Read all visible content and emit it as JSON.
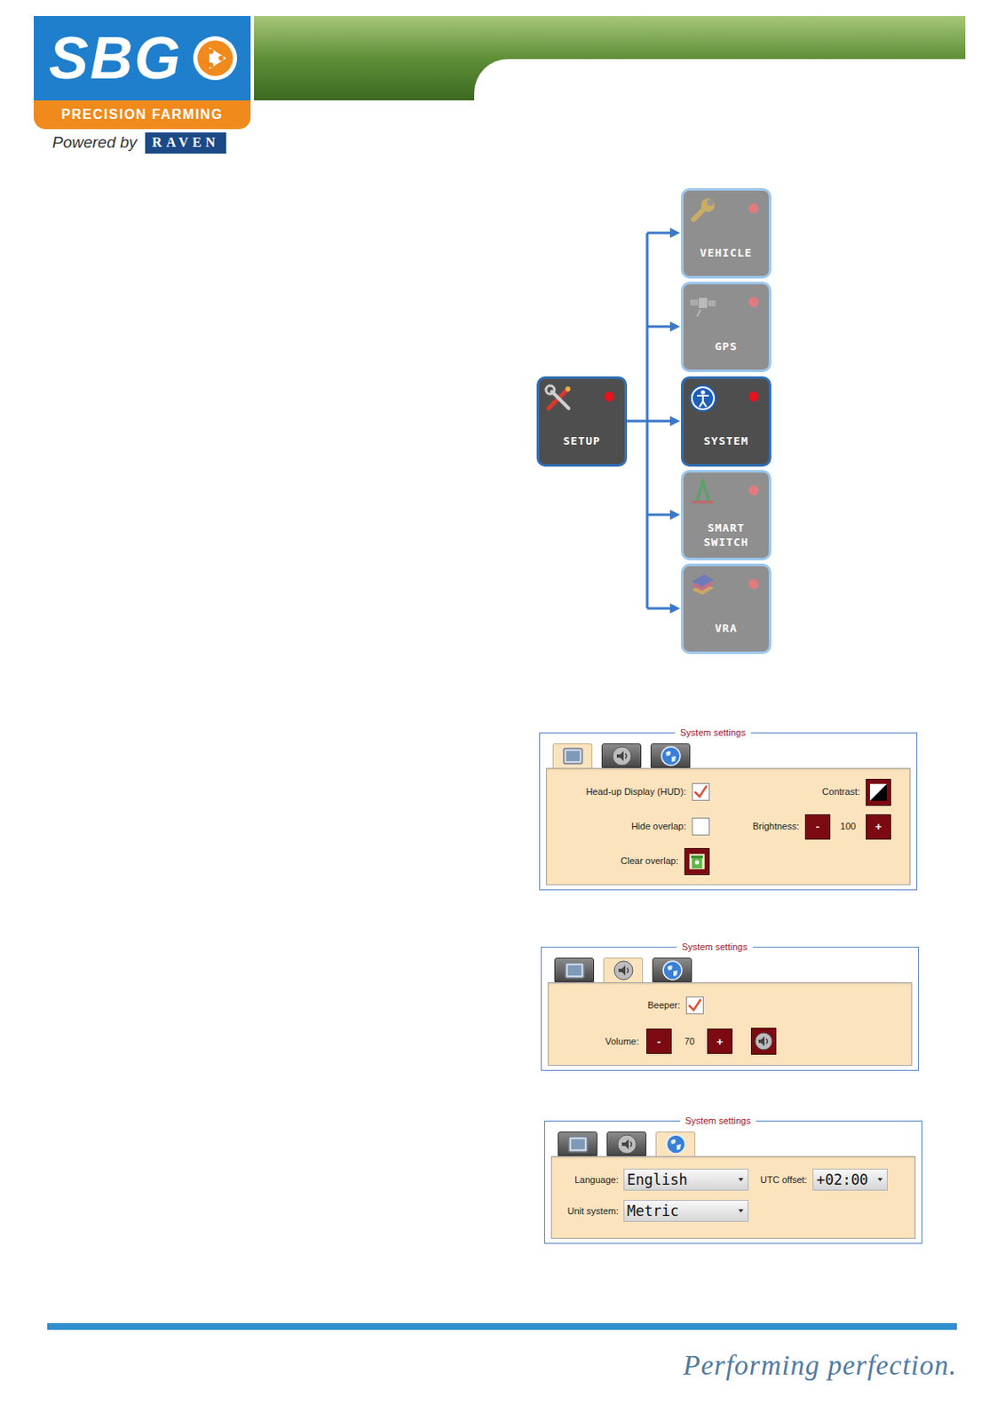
{
  "logo": {
    "brand": "SBG",
    "tagline": "PRECISION FARMING",
    "powered_by": "Powered by",
    "partner": "RAVEN"
  },
  "diagram": {
    "root": {
      "label": "SETUP",
      "active": true
    },
    "items": [
      {
        "label": "VEHICLE",
        "selected": false
      },
      {
        "label": "GPS",
        "selected": false
      },
      {
        "label": "SYSTEM",
        "selected": true
      },
      {
        "label": "SMART SWITCH",
        "selected": false
      },
      {
        "label": "VRA",
        "selected": false
      }
    ]
  },
  "panels": [
    {
      "title": "System settings",
      "kind": "display",
      "tabs": [
        {
          "selected": true
        },
        {
          "selected": false
        },
        {
          "selected": false
        }
      ],
      "fields": [
        {
          "kind": "checkbox",
          "label": "Head-up Display (HUD):",
          "checked": true
        },
        {
          "kind": "button",
          "label": "Contrast:"
        },
        {
          "kind": "checkbox",
          "label": "Hide overlap:",
          "checked": false
        },
        {
          "kind": "stepper",
          "label": "Brightness:",
          "minus": "-",
          "value": "100",
          "plus": "+"
        },
        {
          "kind": "button",
          "label": "Clear overlap:"
        }
      ]
    },
    {
      "title": "System settings",
      "kind": "sound",
      "tabs": [
        {
          "selected": false
        },
        {
          "selected": true
        },
        {
          "selected": false
        }
      ],
      "fields": [
        {
          "kind": "checkbox",
          "label": "Beeper:",
          "checked": true
        },
        {
          "kind": "stepper",
          "label": "Volume:",
          "minus": "-",
          "value": "70",
          "plus": "+"
        },
        {
          "kind": "icon-button"
        }
      ]
    },
    {
      "title": "System settings",
      "kind": "region",
      "tabs": [
        {
          "selected": false
        },
        {
          "selected": false
        },
        {
          "selected": true
        }
      ],
      "fields": [
        {
          "kind": "select",
          "label": "Language:",
          "value": "English"
        },
        {
          "kind": "select",
          "label": "UTC offset:",
          "value": "+02:00"
        },
        {
          "kind": "select",
          "label": "Unit system:",
          "value": "Metric"
        }
      ]
    }
  ],
  "footer": {
    "slogan": "Performing perfection."
  }
}
